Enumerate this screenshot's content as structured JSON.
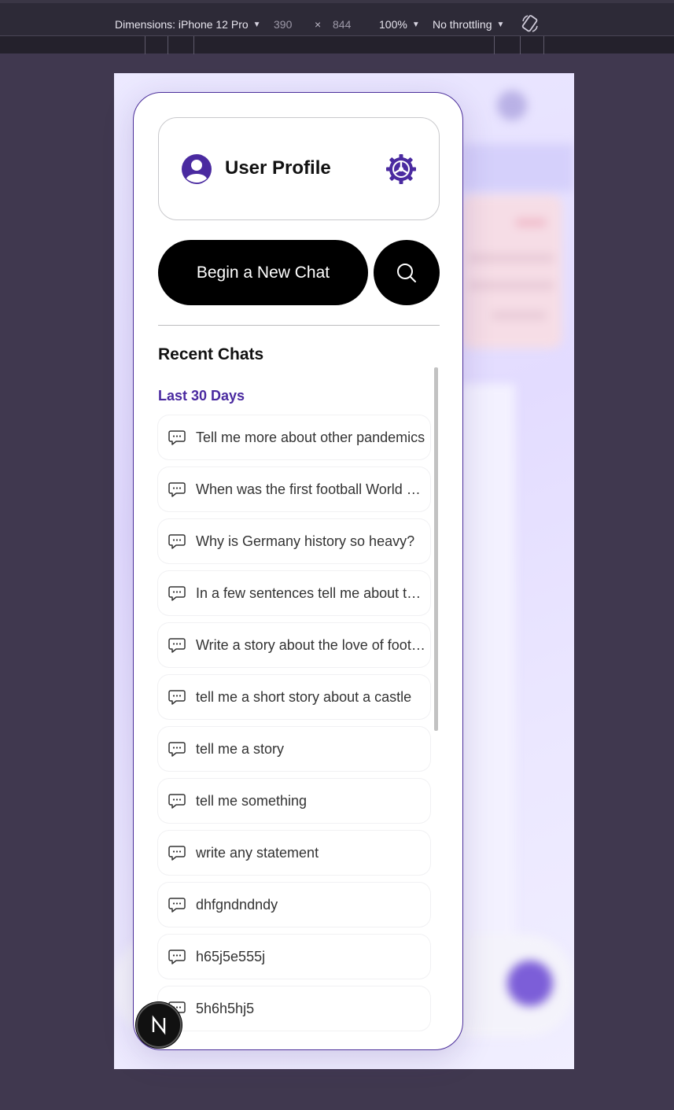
{
  "devtools": {
    "dimensions_label": "Dimensions: iPhone 12 Pro",
    "width_value": "390",
    "times": "×",
    "height_value": "844",
    "zoom": "100%",
    "throttling": "No throttling",
    "rotate_icon": "rotate-icon"
  },
  "sidebar": {
    "profile_title": "User Profile",
    "profile_icon": "user-circle-icon",
    "settings_icon": "gear-icon",
    "new_chat_label": "Begin a New Chat",
    "search_icon": "search-icon",
    "recent_heading": "Recent Chats",
    "period_label": "Last 30 Days",
    "chats": [
      {
        "title": "Tell me more about other pandemics"
      },
      {
        "title": "When was the first football World Cup?"
      },
      {
        "title": "Why is Germany history so heavy?"
      },
      {
        "title": "In a few sentences tell me about the history"
      },
      {
        "title": "Write a story about the love of football"
      },
      {
        "title": "tell me a short story about a castle"
      },
      {
        "title": "tell me a story"
      },
      {
        "title": "tell me something"
      },
      {
        "title": "write any statement"
      },
      {
        "title": "dhfgndndndy"
      },
      {
        "title": "h65j5e555j"
      },
      {
        "title": "5h6h5hj5"
      }
    ]
  },
  "badge": {
    "letter": "N"
  },
  "colors": {
    "accent": "#4a2aa0",
    "button_bg": "#000000",
    "frame_bg": "#40384f"
  }
}
